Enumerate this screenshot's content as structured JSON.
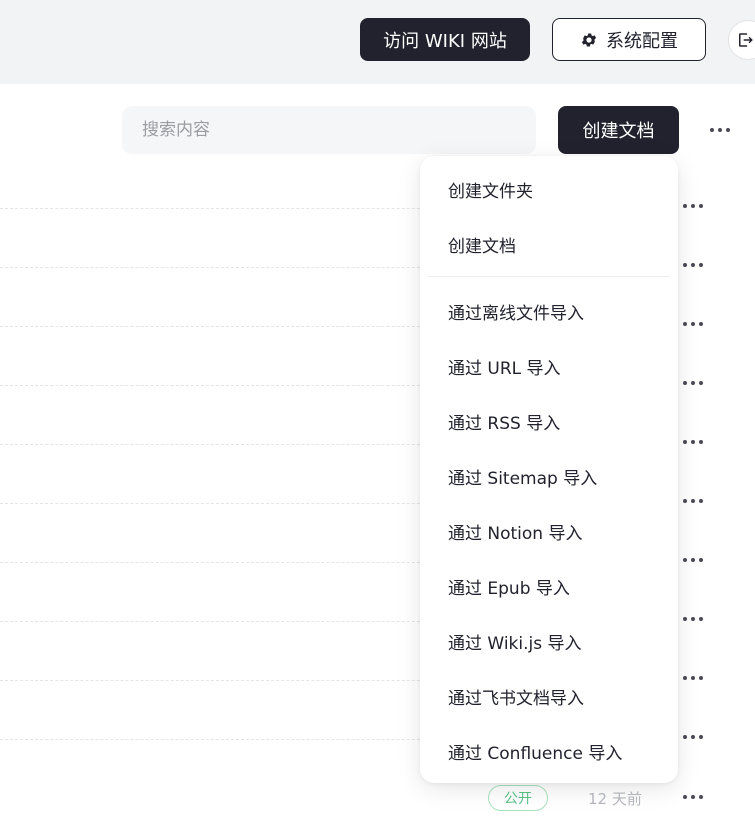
{
  "header": {
    "visit_wiki_label": "访问 WIKI 网站",
    "system_config_label": "系统配置",
    "system_config_icon": "gear-icon",
    "logout_icon": "logout-icon"
  },
  "toolbar": {
    "search_placeholder": "搜索内容",
    "create_doc_label": "创建文档",
    "more_icon": "more-dots-icon"
  },
  "create_menu": {
    "items": [
      "创建文件夹",
      "创建文档",
      "通过离线文件导入",
      "通过 URL 导入",
      "通过 RSS 导入",
      "通过 Sitemap 导入",
      "通过 Notion 导入",
      "通过 Epub 导入",
      "通过 Wiki.js 导入",
      "通过飞书文档导入",
      "通过 Confluence 导入"
    ]
  },
  "doc_list": {
    "last_row": {
      "visibility_badge": "公开",
      "updated": "12 天前"
    }
  },
  "colors": {
    "dark_button": "#21222d",
    "topbar_bg": "#f2f3f5",
    "badge_green": "#58c488"
  }
}
